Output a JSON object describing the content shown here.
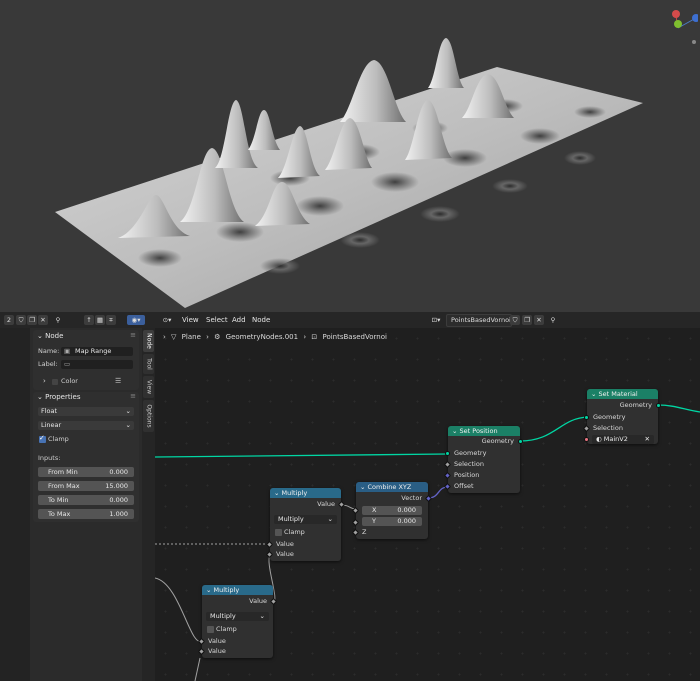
{
  "header": {
    "slot_number": "2",
    "menu": [
      "View",
      "Select",
      "Add",
      "Node"
    ],
    "node_tree_name": "PointsBasedVornoi"
  },
  "breadcrumb": [
    "Plane",
    "GeometryNodes.001",
    "PointsBasedVornoi"
  ],
  "sidebar": {
    "tabs": [
      "Node",
      "Tool",
      "View",
      "Options"
    ],
    "node_panel": {
      "title": "Node",
      "name_label": "Name:",
      "name_value": "Map Range",
      "label_label": "Label:",
      "label_value": "",
      "color_label": "Color"
    },
    "properties_panel": {
      "title": "Properties",
      "data_type": "Float",
      "interpolation": "Linear",
      "clamp_label": "Clamp",
      "clamp_checked": true,
      "inputs_label": "Inputs:",
      "inputs": [
        {
          "label": "From Min",
          "value": "0.000"
        },
        {
          "label": "From Max",
          "value": "15.000"
        },
        {
          "label": "To Min",
          "value": "0.000"
        },
        {
          "label": "To Max",
          "value": "1.000"
        }
      ]
    }
  },
  "nodes": {
    "set_material": {
      "title": "Set Material",
      "out_geometry": "Geometry",
      "in_geometry": "Geometry",
      "selection": "Selection",
      "material": "MainV2"
    },
    "set_position": {
      "title": "Set Position",
      "out_geometry": "Geometry",
      "in_geometry": "Geometry",
      "selection": "Selection",
      "position": "Position",
      "offset": "Offset"
    },
    "combine_xyz": {
      "title": "Combine XYZ",
      "out_vector": "Vector",
      "x_label": "X",
      "x_value": "0.000",
      "y_label": "Y",
      "y_value": "0.000",
      "z_label": "Z"
    },
    "multiply_1": {
      "title": "Multiply",
      "out_value": "Value",
      "operation": "Multiply",
      "clamp_label": "Clamp",
      "in_value_1": "Value",
      "in_value_2": "Value"
    },
    "multiply_2": {
      "title": "Multiply",
      "out_value": "Value",
      "operation": "Multiply",
      "clamp_label": "Clamp",
      "in_value_1": "Value",
      "in_value_2": "Value"
    }
  },
  "colors": {
    "geometry_socket": "#00d6a3",
    "vector_socket": "#6363c7",
    "float_socket": "#a1a1a1",
    "geometry_header": "#1b8066",
    "utility_header": "#296a8a"
  }
}
